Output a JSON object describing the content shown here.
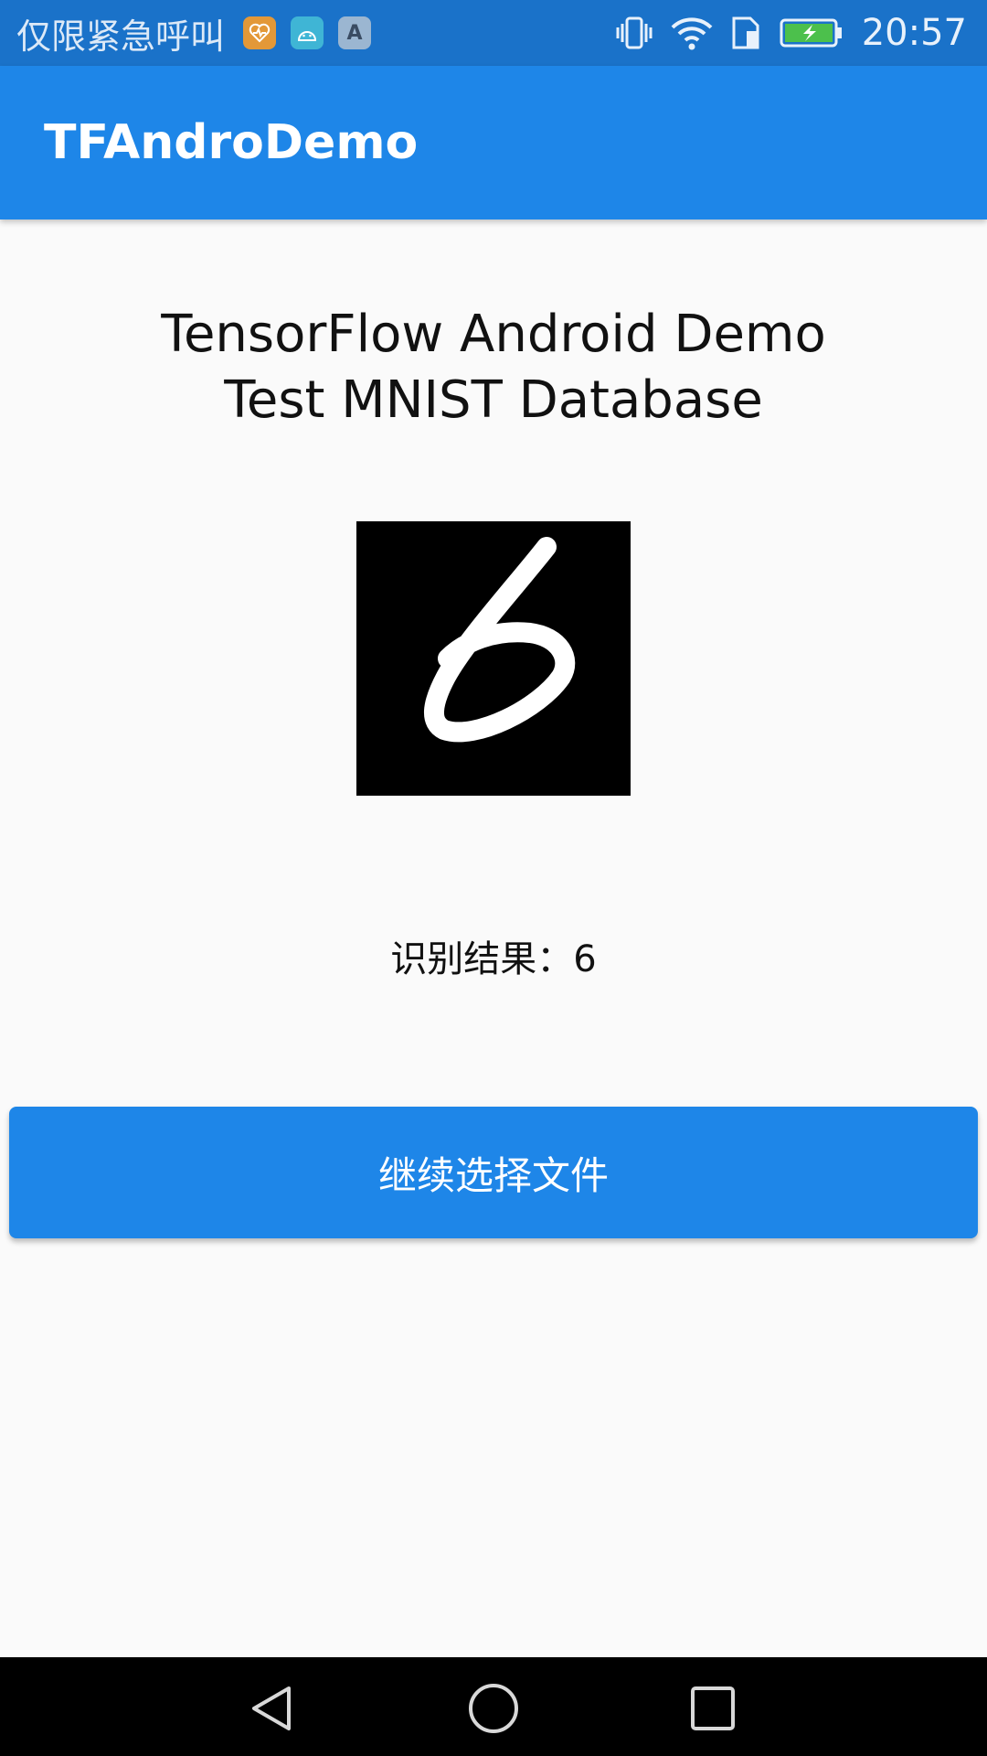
{
  "status_bar": {
    "carrier": "仅限紧急呼叫",
    "notif_icons": [
      "health-app-icon",
      "android-icon",
      "a-app-icon"
    ],
    "notif_a_label": "A",
    "icons": [
      "vibrate-icon",
      "wifi-icon",
      "sim-icon",
      "battery-charging-icon"
    ],
    "time": "20:57"
  },
  "app_bar": {
    "title": "TFAndroDemo"
  },
  "main": {
    "heading_line1": "TensorFlow Android Demo",
    "heading_line2": "Test MNIST Database",
    "image": "handwritten-digit-6",
    "result_label": "识别结果：",
    "result_value": "6",
    "button_label": "继续选择文件"
  },
  "nav_bar": {
    "icons": [
      "back-icon",
      "home-icon",
      "recents-icon"
    ]
  },
  "colors": {
    "status_bar": "#1a72c9",
    "app_bar": "#1e86e8",
    "button": "#1e86e8",
    "background": "#fafafa"
  }
}
